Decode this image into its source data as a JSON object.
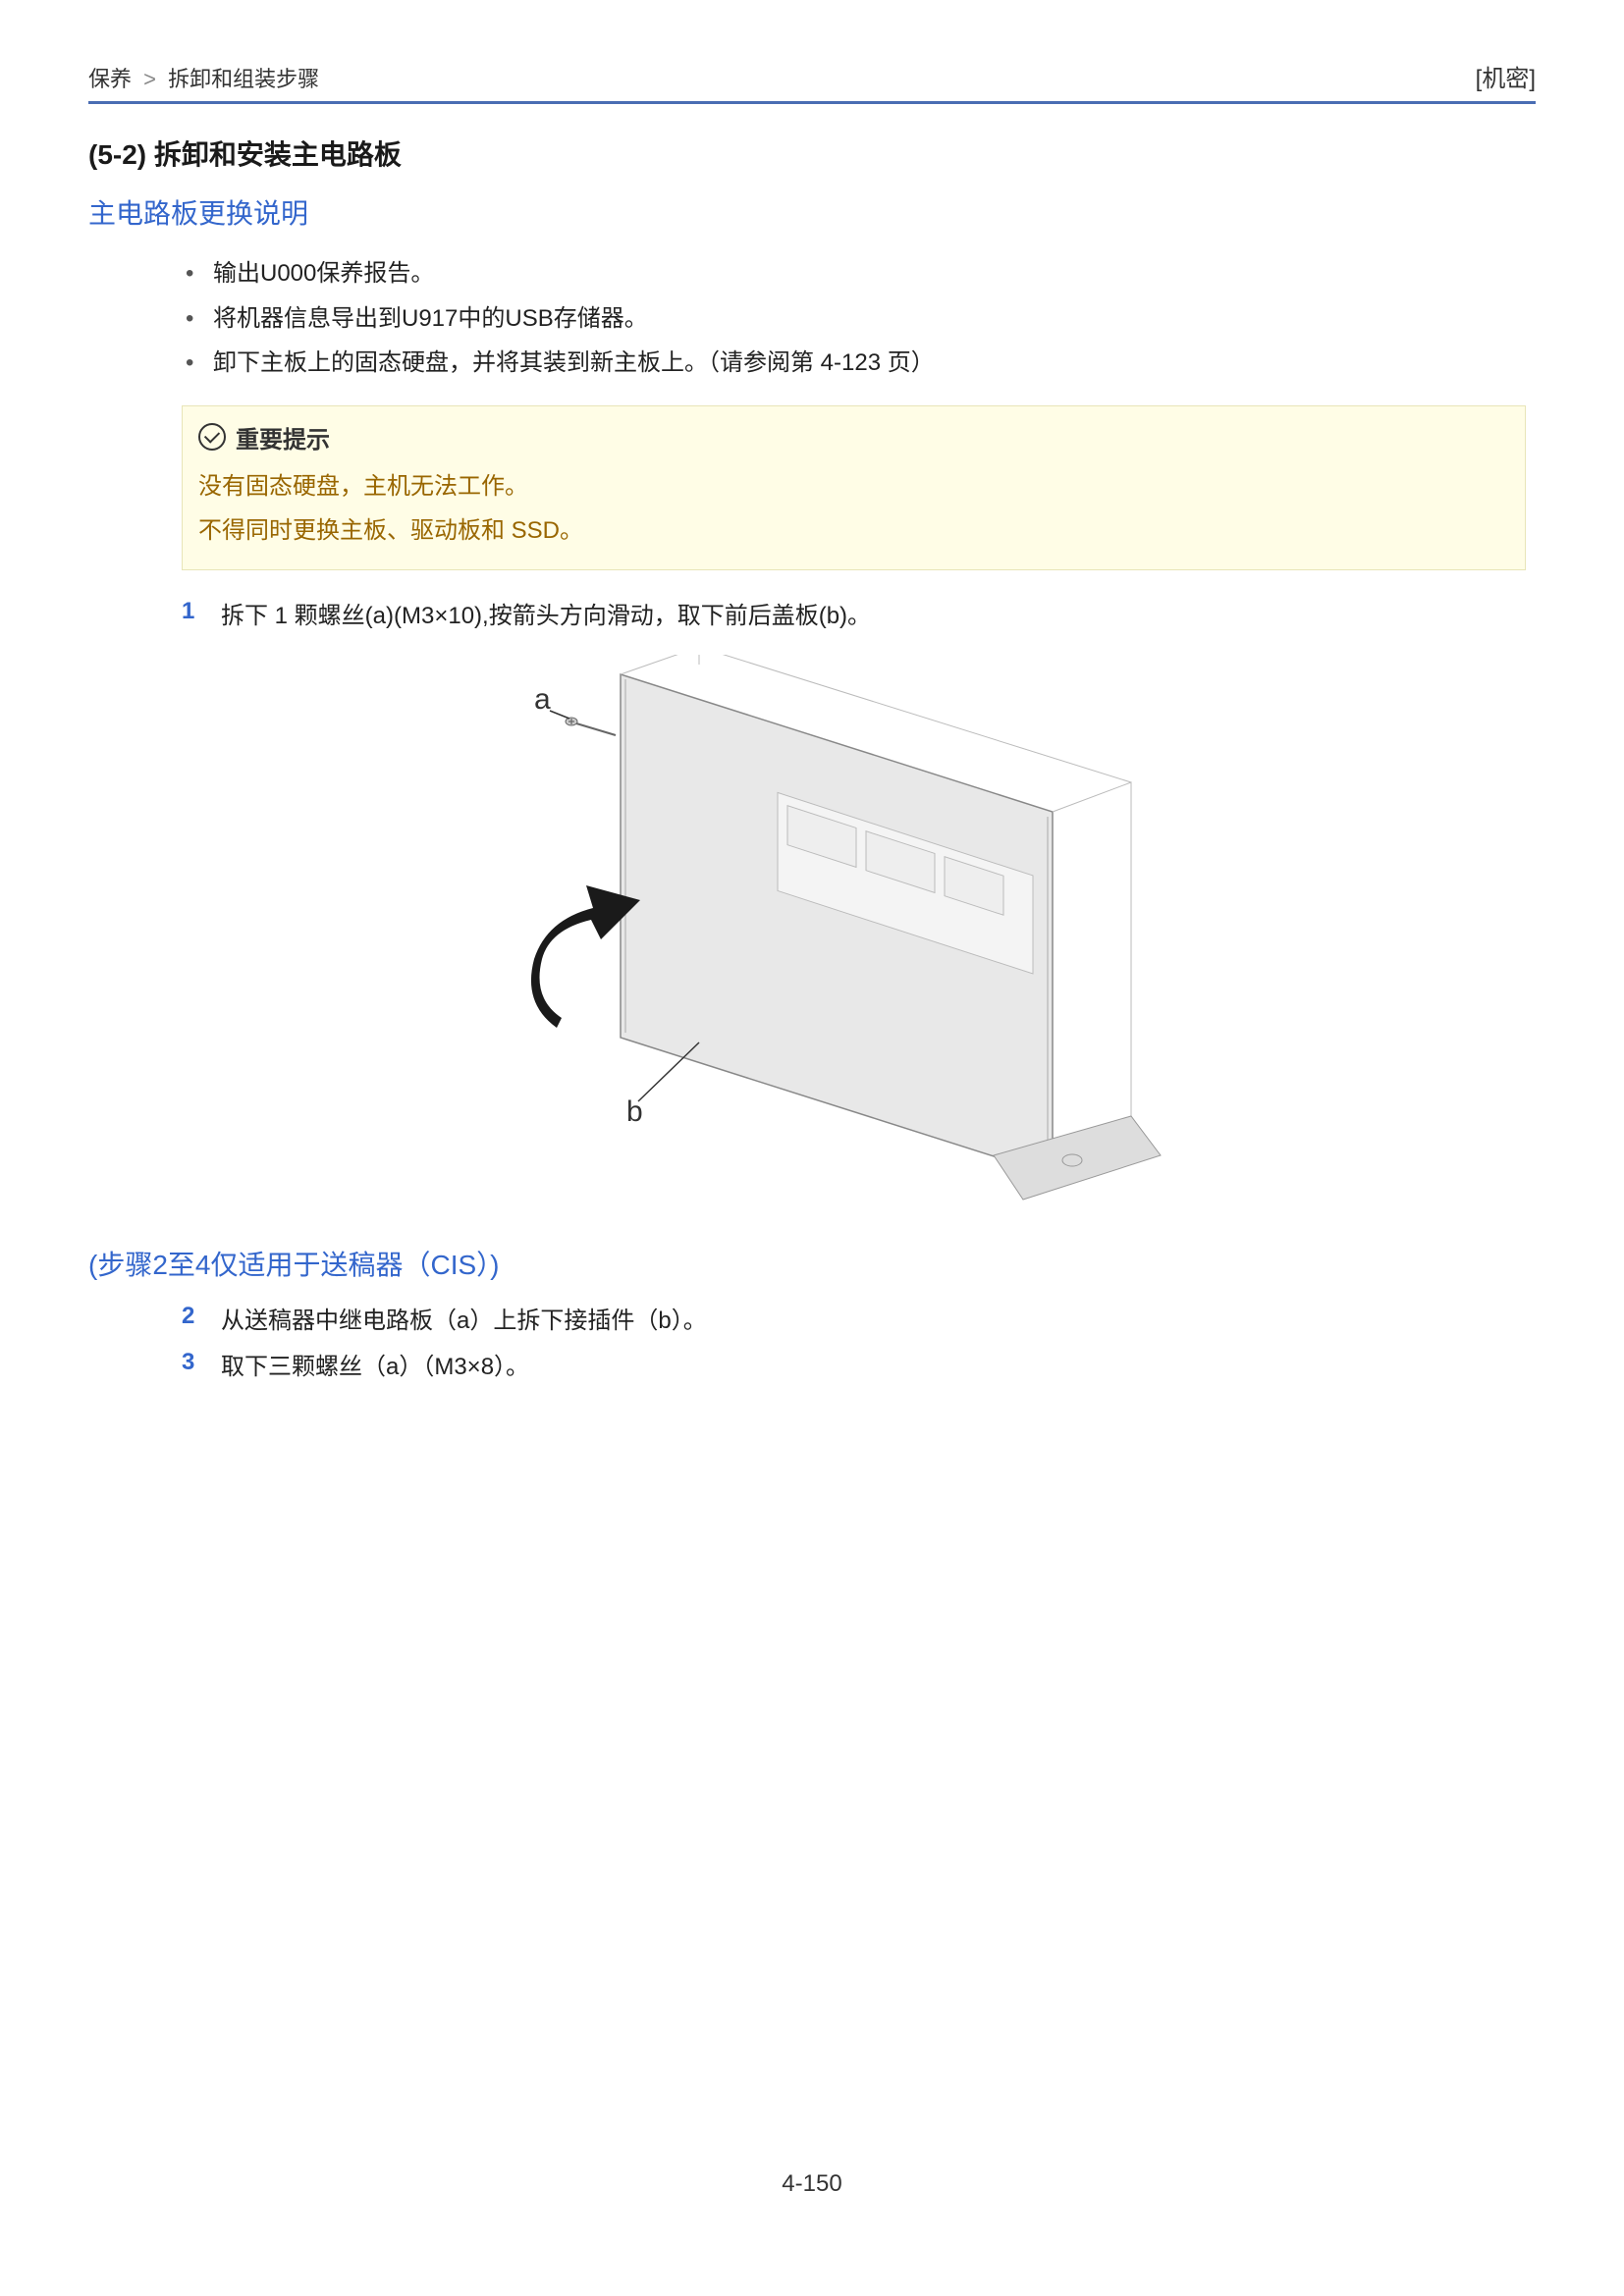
{
  "header": {
    "breadcrumb_parent": "保养",
    "breadcrumb_current": "拆卸和组装步骤",
    "confidential": "[机密]"
  },
  "section": {
    "number_title": "(5-2) 拆卸和安装主电路板",
    "subsection_title": "主电路板更换说明"
  },
  "bullets": {
    "item1": "输出U000保养报告。",
    "item2": "将机器信息导出到U917中的USB存储器。",
    "item3": "卸下主板上的固态硬盘，并将其装到新主板上。（请参阅第 4-123 页）"
  },
  "important": {
    "title": "重要提示",
    "line1": "没有固态硬盘，主机无法工作。",
    "line2": "不得同时更换主板、驱动板和 SSD。"
  },
  "steps": {
    "s1_num": "1",
    "s1_text": "拆下 1 颗螺丝(a)(M3×10),按箭头方向滑动，取下前后盖板(b)。",
    "s2_num": "2",
    "s2_text": "从送稿器中继电路板（a）上拆下接插件（b）。",
    "s3_num": "3",
    "s3_text": "取下三颗螺丝（a）（M3×8）。"
  },
  "subsection2": {
    "title": "(步骤2至4仅适用于送稿器（CIS）)"
  },
  "figure": {
    "label_a": "a",
    "label_b": "b"
  },
  "footer": {
    "page_number": "4-150"
  }
}
